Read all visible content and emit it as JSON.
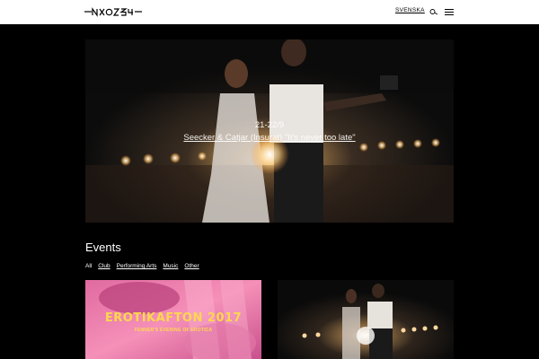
{
  "header": {
    "language_link": "SVENSKA",
    "icons": {
      "logo": "logo",
      "search": "search-icon",
      "menu": "hamburger-menu-icon"
    }
  },
  "hero": {
    "date": "21-22/9",
    "title_underlined": "Seecker & Catjar (Insurat) \"It's never too late\"",
    "image": "photo of two performers on a stage with lights"
  },
  "events": {
    "heading": "Events",
    "filters": [
      "All",
      "Club",
      "Performing Arts",
      "Music",
      "Other"
    ],
    "cards": [
      {
        "title": "EROTIKAFTON 2017",
        "subtitle": "FENNER'S EVENING OF EROTICA"
      },
      {
        "title": ""
      }
    ]
  }
}
